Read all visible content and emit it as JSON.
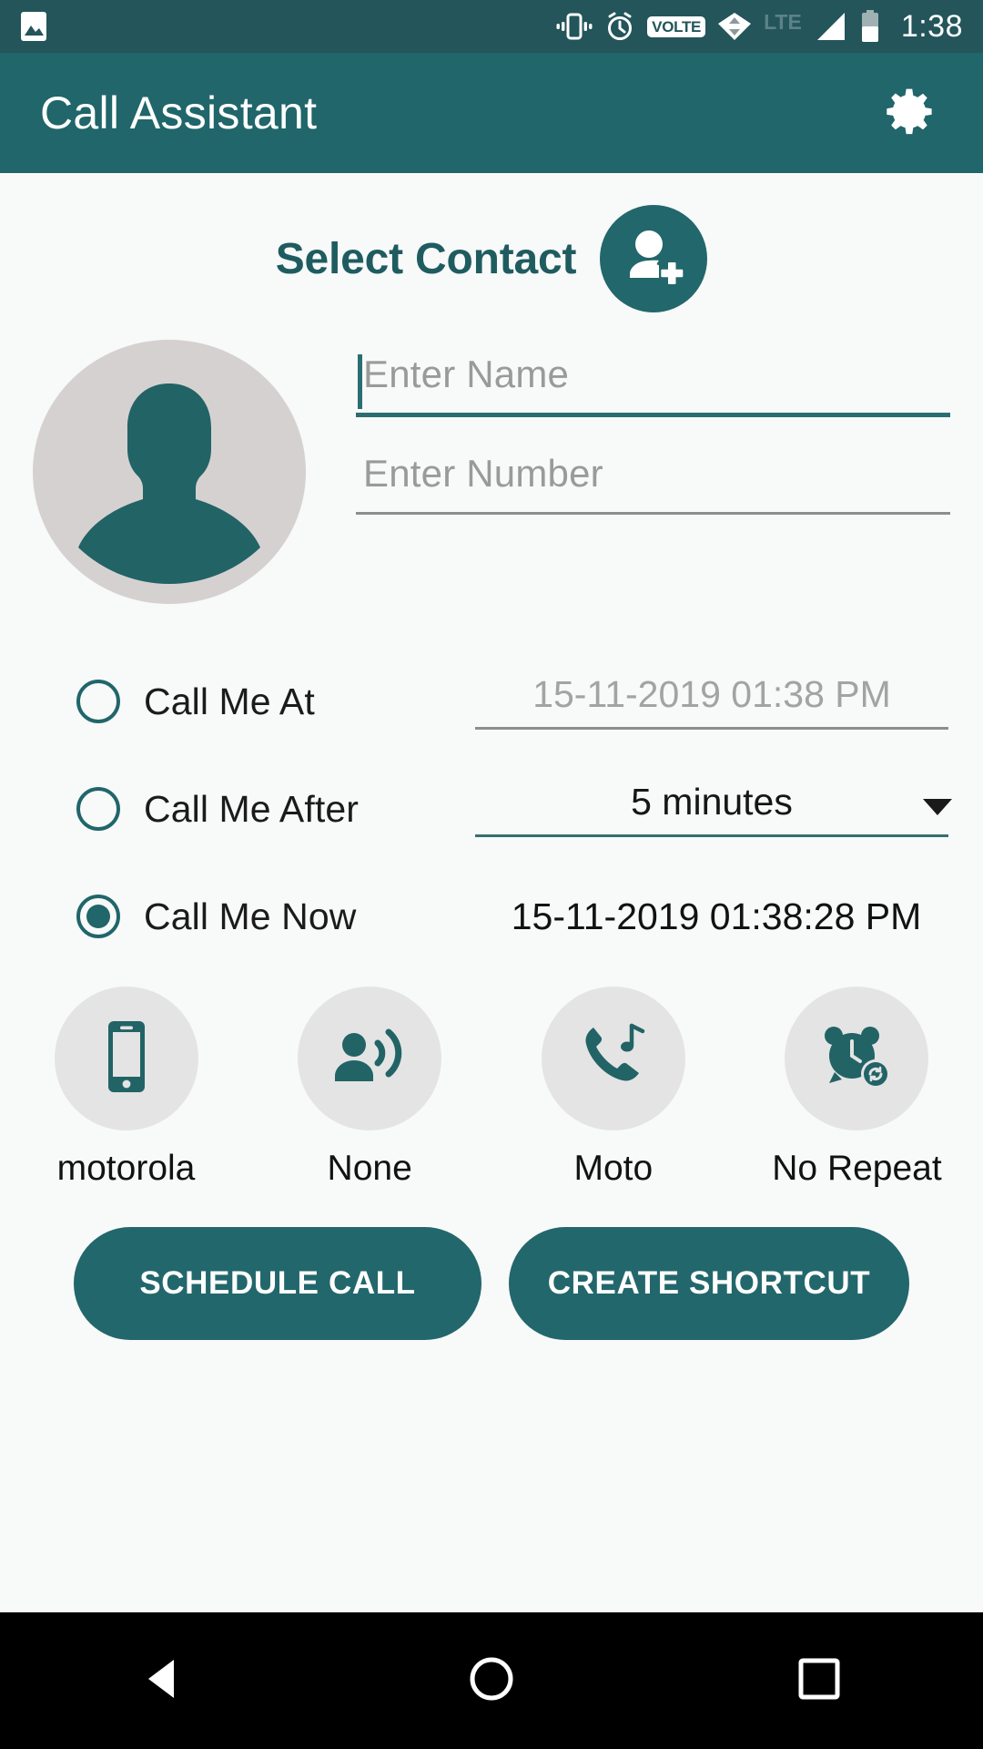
{
  "status_bar": {
    "time": "1:38",
    "icons": [
      "image-icon",
      "vibrate-icon",
      "alarm-icon",
      "volte-badge",
      "data-transfer-icon",
      "lte-label",
      "signal-icon",
      "battery-icon"
    ],
    "volte_label": "VOLTE",
    "network_label": "LTE"
  },
  "app_bar": {
    "title": "Call Assistant",
    "settings_icon": "gear-icon"
  },
  "contact": {
    "section_title": "Select Contact",
    "add_contact_icon": "add-person-icon",
    "avatar_icon": "person-placeholder-avatar",
    "name_field": {
      "value": "",
      "placeholder": "Enter Name",
      "focused": true
    },
    "number_field": {
      "value": "",
      "placeholder": "Enter Number",
      "focused": false
    }
  },
  "schedule": {
    "options": [
      {
        "label": "Call Me At",
        "selected": false,
        "value": "15-11-2019 01:38 PM",
        "control": "datetime"
      },
      {
        "label": "Call Me After",
        "selected": false,
        "value": "5 minutes",
        "control": "dropdown"
      },
      {
        "label": "Call Me Now",
        "selected": true,
        "value": "15-11-2019 01:38:28 PM",
        "control": "static"
      }
    ]
  },
  "options_row": [
    {
      "label": "motorola",
      "icon": "phone-device-icon"
    },
    {
      "label": "None",
      "icon": "person-speaking-icon"
    },
    {
      "label": "Moto",
      "icon": "phone-ringtone-icon"
    },
    {
      "label": "No Repeat",
      "icon": "alarm-repeat-icon"
    }
  ],
  "actions": {
    "schedule_call": "SCHEDULE CALL",
    "create_shortcut": "CREATE SHORTCUT"
  },
  "nav_bar": {
    "back": "back-triangle-icon",
    "home": "home-circle-icon",
    "recents": "recents-square-icon"
  },
  "colors": {
    "status_bar": "#23555a",
    "app_bar": "#20666a",
    "accent": "#22676b",
    "background": "#f8f9f9",
    "avatar_bg": "#d6d1d1",
    "option_circle": "#e4e4e4"
  }
}
